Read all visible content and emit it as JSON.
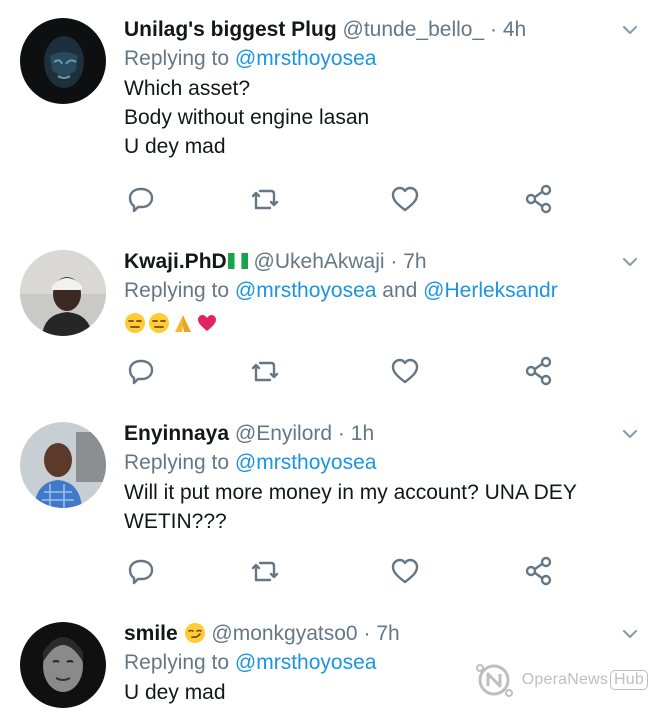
{
  "tweets": [
    {
      "name": "Unilag's biggest Plug",
      "handle": "@tunde_bello_",
      "sep": "·",
      "time": "4h",
      "replying_prefix": "Replying to ",
      "mention1": "@mrsthoyosea",
      "lines": [
        "Which asset?",
        "Body without engine lasan",
        "U dey mad"
      ]
    },
    {
      "name": "Kwaji.PhD",
      "handle": "@UkehAkwaji",
      "sep": "·",
      "time": "7h",
      "replying_prefix": "Replying to ",
      "mention1": "@mrsthoyosea",
      "conj": " and ",
      "mention2": "@Herleksandr",
      "emojis": [
        "expressionless-face",
        "expressionless-face",
        "folded-hands",
        "heart"
      ]
    },
    {
      "name": "Enyinnaya",
      "handle": "@Enyilord",
      "sep": "·",
      "time": "1h",
      "replying_prefix": "Replying to ",
      "mention1": "@mrsthoyosea",
      "lines": [
        "Will it put more money in my account? UNA DEY",
        "WETIN???"
      ]
    },
    {
      "name": "smile",
      "handle": "@monkgyatso0",
      "sep": "·",
      "time": "7h",
      "replying_prefix": "Replying to ",
      "mention1": "@mrsthoyosea",
      "lines": [
        "U dey mad"
      ]
    }
  ],
  "icons": [
    "reply-icon",
    "retweet-icon",
    "like-icon",
    "share-icon",
    "chevron-down-icon"
  ],
  "colors": {
    "text": "#14171a",
    "secondary": "#657786",
    "link": "#1b95e0",
    "divider": "#dcdfe2"
  },
  "watermark": {
    "main": "OperaNews",
    "badge": "Hub"
  }
}
